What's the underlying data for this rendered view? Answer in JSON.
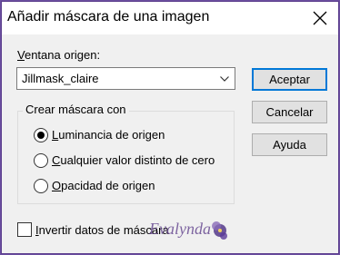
{
  "window": {
    "title": "Añadir máscara de una imagen"
  },
  "source": {
    "label": "Ventana origen:",
    "selected": "Jillmask_claire"
  },
  "buttons": {
    "ok": "Aceptar",
    "cancel": "Cancelar",
    "help": "Ayuda"
  },
  "mask_group": {
    "legend": "Crear máscara con",
    "options": [
      {
        "label": "Luminancia de origen",
        "selected": true
      },
      {
        "label": "Cualquier valor distinto de cero",
        "selected": false
      },
      {
        "label": "Opacidad de origen",
        "selected": false
      }
    ]
  },
  "invert": {
    "label": "Invertir datos de máscara",
    "checked": false
  },
  "watermark": {
    "text": "Evalynda"
  },
  "colors": {
    "frame": "#6b4fa0",
    "focus_blue": "#0078d7",
    "dialog_bg": "#f0f0f0"
  }
}
